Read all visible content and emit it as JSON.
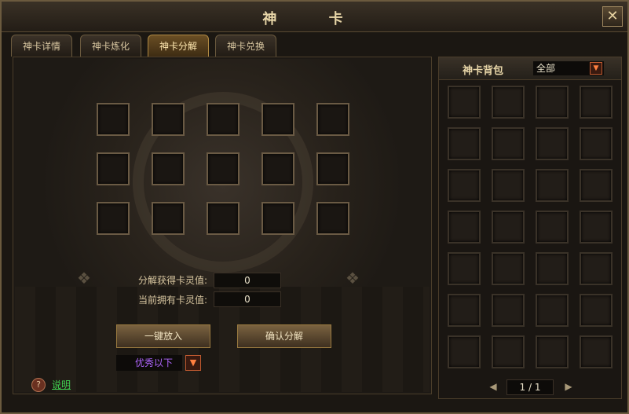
{
  "window": {
    "title": "神  卡",
    "close_glyph": "✕"
  },
  "tabs": [
    {
      "label": "神卡详情",
      "active": false
    },
    {
      "label": "神卡炼化",
      "active": false
    },
    {
      "label": "神卡分解",
      "active": true
    },
    {
      "label": "神卡兑换",
      "active": false
    }
  ],
  "decompose": {
    "slot_count": 15,
    "gain_label": "分解获得卡灵值:",
    "gain_value": "0",
    "owned_label": "当前拥有卡灵值:",
    "owned_value": "0",
    "auto_fill_button": "一键放入",
    "confirm_button": "确认分解",
    "quality_filter": {
      "selected": "优秀以下"
    },
    "help_link": "说明",
    "help_glyph": "?"
  },
  "backpack": {
    "title": "神卡背包",
    "filter": {
      "selected": "全部"
    },
    "slot_count": 28,
    "pager": {
      "value": "1 / 1",
      "prev_glyph": "◀",
      "next_glyph": "▶"
    }
  },
  "colors": {
    "accent": "#c05a30",
    "quality_text": "#b066ff",
    "help_link": "#40d050"
  }
}
